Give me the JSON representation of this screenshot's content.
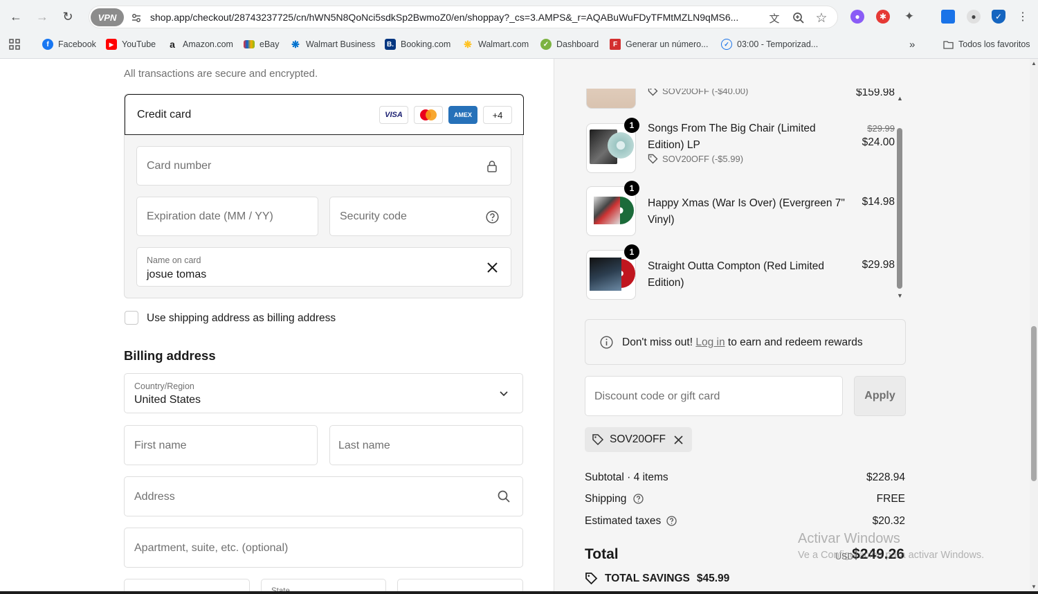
{
  "browser": {
    "vpn_label": "VPN",
    "url": "shop.app/checkout/28743237725/cn/hWN5N8QoNci5sdkSp2BwmoZ0/en/shoppay?_cs=3.AMPS&_r=AQABuWuFDyTFMtMZLN9qMS6...",
    "bookmarks": [
      {
        "label": "Facebook",
        "icon": "facebook-icon",
        "color": "#1877f2"
      },
      {
        "label": "YouTube",
        "icon": "youtube-icon",
        "color": "#ff0000"
      },
      {
        "label": "Amazon.com",
        "icon": "amazon-icon",
        "color": "#222222"
      },
      {
        "label": "eBay",
        "icon": "ebay-icon",
        "color": "#e53238"
      },
      {
        "label": "Walmart Business",
        "icon": "walmart-spark-icon",
        "color": "#0071ce"
      },
      {
        "label": "Booking.com",
        "icon": "booking-icon",
        "color": "#003580"
      },
      {
        "label": "Walmart.com",
        "icon": "walmart-spark-icon",
        "color": "#ffc220"
      },
      {
        "label": "Dashboard",
        "icon": "dashboard-icon",
        "color": "#7cb342"
      },
      {
        "label": "Generar un número...",
        "icon": "f-icon",
        "color": "#d32f2f"
      },
      {
        "label": "03:00 - Temporizad...",
        "icon": "timer-icon",
        "color": "#1a73e8"
      }
    ],
    "all_bookmarks_label": "Todos los favoritos",
    "more_bookmarks": "»"
  },
  "payment": {
    "secure_text": "All transactions are secure and encrypted.",
    "method_label": "Credit card",
    "card_brands": [
      "VISA",
      "AMEX",
      "+4"
    ],
    "card_number_placeholder": "Card number",
    "expiration_placeholder": "Expiration date (MM / YY)",
    "security_placeholder": "Security code",
    "name_label": "Name on card",
    "name_value": "josue tomas",
    "use_shipping_label": "Use shipping address as billing address",
    "use_shipping_checked": false
  },
  "billing": {
    "heading": "Billing address",
    "country_label": "Country/Region",
    "country_value": "United States",
    "first_name_placeholder": "First name",
    "last_name_placeholder": "Last name",
    "address_placeholder": "Address",
    "apartment_placeholder": "Apartment, suite, etc. (optional)",
    "state_label": "State"
  },
  "order": {
    "items": [
      {
        "name": "",
        "price": "$159.98",
        "discount": "SOV20OFF (-$40.00)"
      },
      {
        "name": "Songs From The Big Chair (Limited Edition) LP",
        "qty": "1",
        "original_price": "$29.99",
        "price": "$24.00",
        "discount": "SOV20OFF (-$5.99)"
      },
      {
        "name": "Happy Xmas (War Is Over) (Evergreen 7\" Vinyl)",
        "qty": "1",
        "price": "$14.98"
      },
      {
        "name": "Straight Outta Compton (Red Limited Edition)",
        "qty": "1",
        "price": "$29.98"
      }
    ],
    "rewards_prefix": "Don't miss out!",
    "rewards_link": "Log in",
    "rewards_suffix": "to earn and redeem rewards",
    "discount_placeholder": "Discount code or gift card",
    "apply_label": "Apply",
    "applied_code": "SOV20OFF",
    "subtotal_label": "Subtotal · 4 items",
    "subtotal_value": "$228.94",
    "shipping_label": "Shipping",
    "shipping_value": "FREE",
    "taxes_label": "Estimated taxes",
    "taxes_value": "$20.32",
    "total_label": "Total",
    "total_currency": "USD",
    "total_value": "$249.26",
    "savings_label": "TOTAL SAVINGS",
    "savings_value": "$45.99"
  },
  "watermark": {
    "line1": "Activar Windows",
    "line2": "Ve a Configuración para activar Windows."
  }
}
